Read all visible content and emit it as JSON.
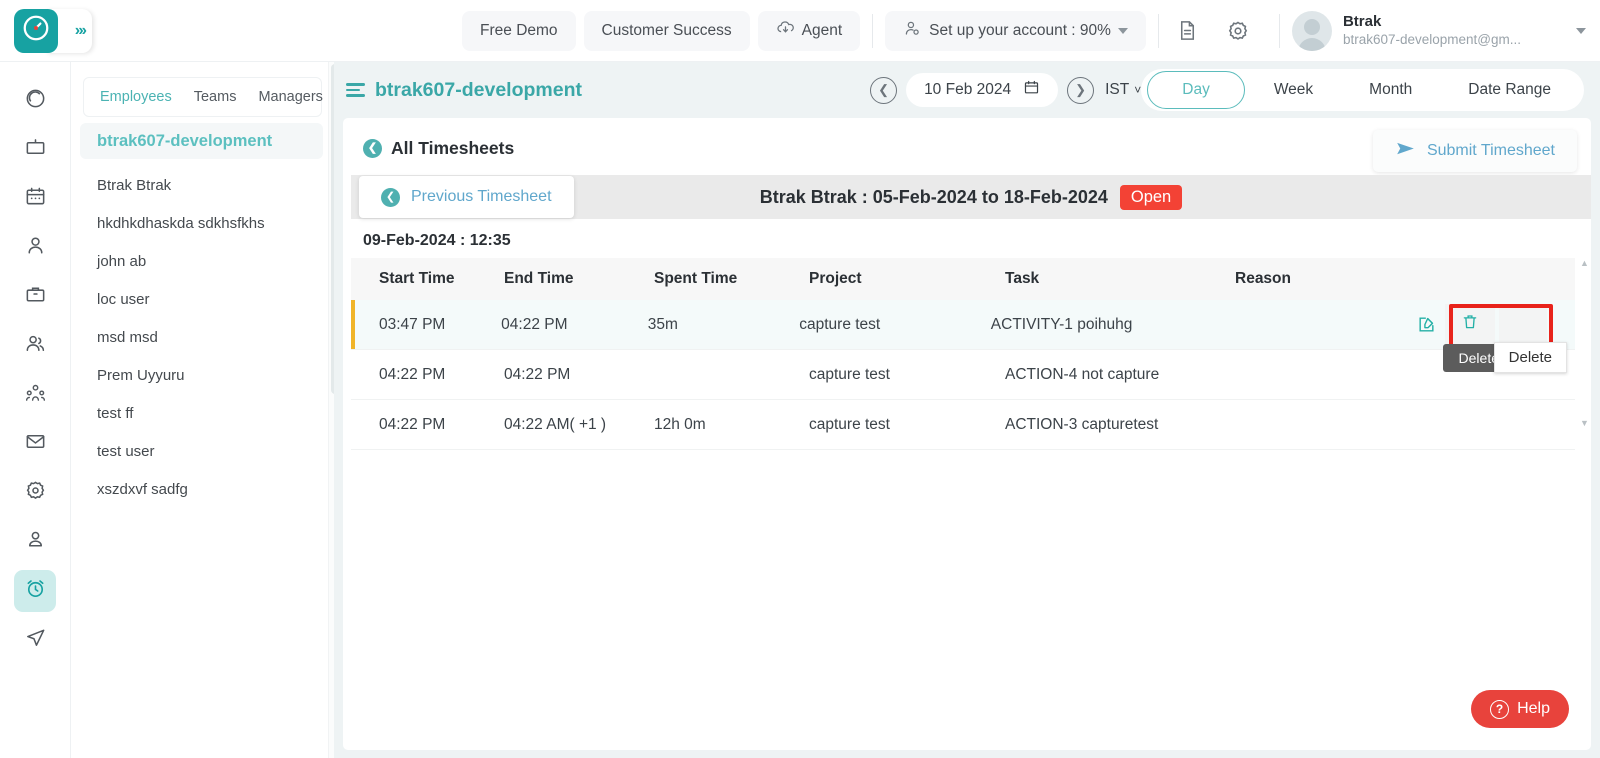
{
  "topbar": {
    "logo_icon": "clock-logo-icon",
    "expand_icon": "chevrons-right-icon",
    "nav_buttons": [
      {
        "label": "Free Demo",
        "icon": null
      },
      {
        "label": "Customer Success",
        "icon": null
      },
      {
        "label": "Agent",
        "icon": "cloud-download-icon"
      }
    ],
    "setup": {
      "label": "Set up your account : 90%",
      "icon": "user-gear-icon"
    },
    "doc_icon": "document-icon",
    "gear_icon": "gear-icon",
    "profile": {
      "name": "Btrak",
      "email": "btrak607-development@gm...",
      "avatar_icon": "avatar-icon",
      "caret_icon": "caret-down-icon"
    }
  },
  "rail": {
    "items": [
      {
        "name": "target",
        "icon": "target-icon",
        "active": false
      },
      {
        "name": "board",
        "icon": "tv-icon",
        "active": false
      },
      {
        "name": "calendar",
        "icon": "calendar-icon",
        "active": false
      },
      {
        "name": "person",
        "icon": "person-icon",
        "active": false
      },
      {
        "name": "briefcase",
        "icon": "briefcase-icon",
        "active": false
      },
      {
        "name": "users",
        "icon": "users-icon",
        "active": false
      },
      {
        "name": "org-chart",
        "icon": "org-chart-icon",
        "active": false
      },
      {
        "name": "mail",
        "icon": "mail-icon",
        "active": false
      },
      {
        "name": "settings",
        "icon": "gear-icon",
        "active": false
      },
      {
        "name": "profile",
        "icon": "user-badge-icon",
        "active": false
      },
      {
        "name": "timesheets",
        "icon": "alarm-clock-icon",
        "active": true
      },
      {
        "name": "send",
        "icon": "paper-plane-icon",
        "active": false
      }
    ]
  },
  "employee_panel": {
    "tabs": [
      {
        "label": "Employees",
        "active": true
      },
      {
        "label": "Teams",
        "active": false
      },
      {
        "label": "Managers",
        "active": false
      }
    ],
    "group_header": "btrak607-development",
    "employees": [
      "Btrak Btrak",
      "hkdhkdhaskda sdkhsfkhs",
      "john ab",
      "loc user",
      "msd msd",
      "Prem Uyyuru",
      "test ff",
      "test user",
      "xszdxvf sadfg"
    ]
  },
  "main_header": {
    "hamburger_icon": "hamburger-icon",
    "project_title": "btrak607-development",
    "prev_day_icon": "chevron-left-circle-icon",
    "next_day_icon": "chevron-right-circle-icon",
    "date": "10 Feb 2024",
    "calendar_icon": "calendar-icon",
    "timezone": "IST",
    "timezone_caret_icon": "chevron-down-icon",
    "range_tabs": [
      {
        "label": "Day",
        "active": true
      },
      {
        "label": "Week",
        "active": false
      },
      {
        "label": "Month",
        "active": false
      },
      {
        "label": "Date Range",
        "active": false
      }
    ]
  },
  "content": {
    "back_icon": "back-arrow-circle-icon",
    "all_timesheets": "All Timesheets",
    "submit_button": {
      "label": "Submit Timesheet",
      "icon": "send-icon"
    },
    "previous_button": {
      "label": "Previous Timesheet",
      "icon": "back-arrow-circle-icon"
    },
    "timesheet_title": "Btrak Btrak : 05-Feb-2024 to 18-Feb-2024",
    "status_badge": "Open",
    "day_label": "09-Feb-2024 : 12:35",
    "table": {
      "columns": [
        "Start Time",
        "End Time",
        "Spent Time",
        "Project",
        "Task",
        "Reason"
      ],
      "rows": [
        {
          "start_time": "03:47 PM",
          "end_time": "04:22 PM",
          "spent_time": "35m",
          "project": "capture test",
          "task": "ACTIVITY-1 poihuhg",
          "reason": "",
          "selected": true,
          "edit_icon": "edit-pencil-icon",
          "delete_icon": "trash-icon"
        },
        {
          "start_time": "04:22 PM",
          "end_time": "04:22 PM",
          "spent_time": "",
          "project": "capture test",
          "task": "ACTION-4 not capture",
          "reason": "",
          "selected": false
        },
        {
          "start_time": "04:22 PM",
          "end_time": "04:22 AM( +1 )",
          "spent_time": "12h 0m",
          "project": "capture test",
          "task": "ACTION-3 capturetest",
          "reason": "",
          "selected": false
        }
      ]
    },
    "tooltip_dark": "Delete",
    "tooltip_white": "Delete",
    "scroll_up_icon": "caret-up-icon",
    "scroll_down_icon": "caret-down-icon"
  },
  "help": {
    "label": "Help",
    "icon": "question-circle-icon"
  },
  "colors": {
    "brand_teal": "#17a2a2",
    "accent_teal": "#5bbcbc",
    "link_blue": "#60a7cc",
    "status_red": "#f34235",
    "help_red": "#e8433c",
    "highlight_red": "#e8241c",
    "row_accent_amber": "#f0b429",
    "main_bg": "#eef3f4"
  }
}
